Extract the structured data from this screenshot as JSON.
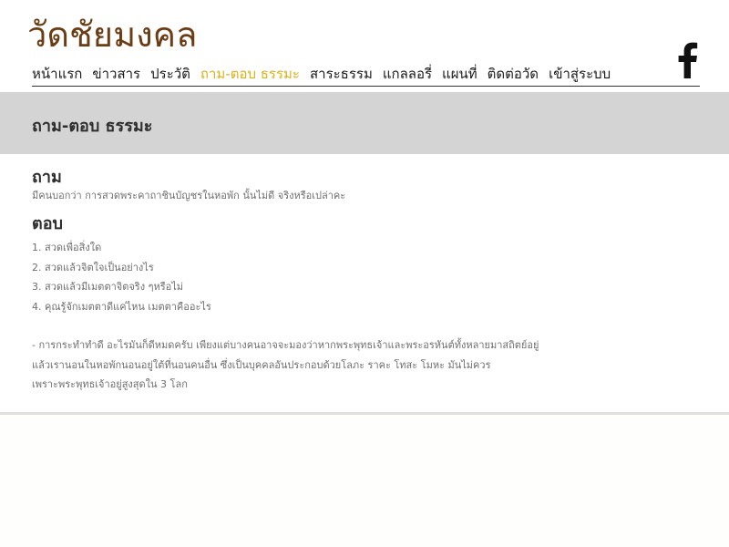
{
  "site": {
    "title": "วัดชัยมงคล"
  },
  "nav": {
    "items": [
      {
        "label": "หน้าแรก"
      },
      {
        "label": "ข่าวสาร"
      },
      {
        "label": "ประวัติ"
      },
      {
        "label": "ถาม-ตอบ ธรรมะ",
        "active": true
      },
      {
        "label": "สาระธรรม"
      },
      {
        "label": "แกลลอรี่"
      },
      {
        "label": "แผนที่"
      },
      {
        "label": "ติดต่อวัด"
      },
      {
        "label": "เข้าสู่ระบบ"
      }
    ],
    "active_color": "#d7b21c"
  },
  "social": {
    "icon": "facebook-icon"
  },
  "page": {
    "title": "ถาม-ตอบ ธรรมะ"
  },
  "question": {
    "heading": "ถาม",
    "text": "มีคนบอกว่า การสวดพระคาถาชินบัญชรในหอพัก นั้นไม่ดี จริงหรือเปล่าคะ"
  },
  "answer": {
    "heading": "ตอบ",
    "list": [
      "1. สวดเพื่อสิ่งใด",
      "2. สวดแล้วจิตใจเป็นอย่างไร",
      "3. สวดแล้วมีเมตตาจิตจริง ๆหรือไม่",
      "4. คุณรู้จักเมตตาดีแค่ไหน เมตตาคืออะไร"
    ],
    "paragraph_lines": [
      "- การกระทำทำดี อะไรมันก็ดีหมดครับ เพียงแต่บางคนอาจจะมองว่าหากพระพุทธเจ้าและพระอรหันต์ทั้งหลายมาสถิตย์อยู่",
      "แล้วเรานอนในหอพักนอนอยู่ใต้ที่นอนคนอื่น ซึ่งเป็นบุคคลอันประกอบด้วยโลภะ ราคะ โทสะ โมหะ มันไม่ควร",
      "เพราะพระพุทธเจ้าอยู่สูงสุดใน 3 โลก"
    ]
  },
  "colors": {
    "title": "#6b3d14",
    "banner": "#d4d4d4",
    "body_text": "#6e6e6e"
  }
}
